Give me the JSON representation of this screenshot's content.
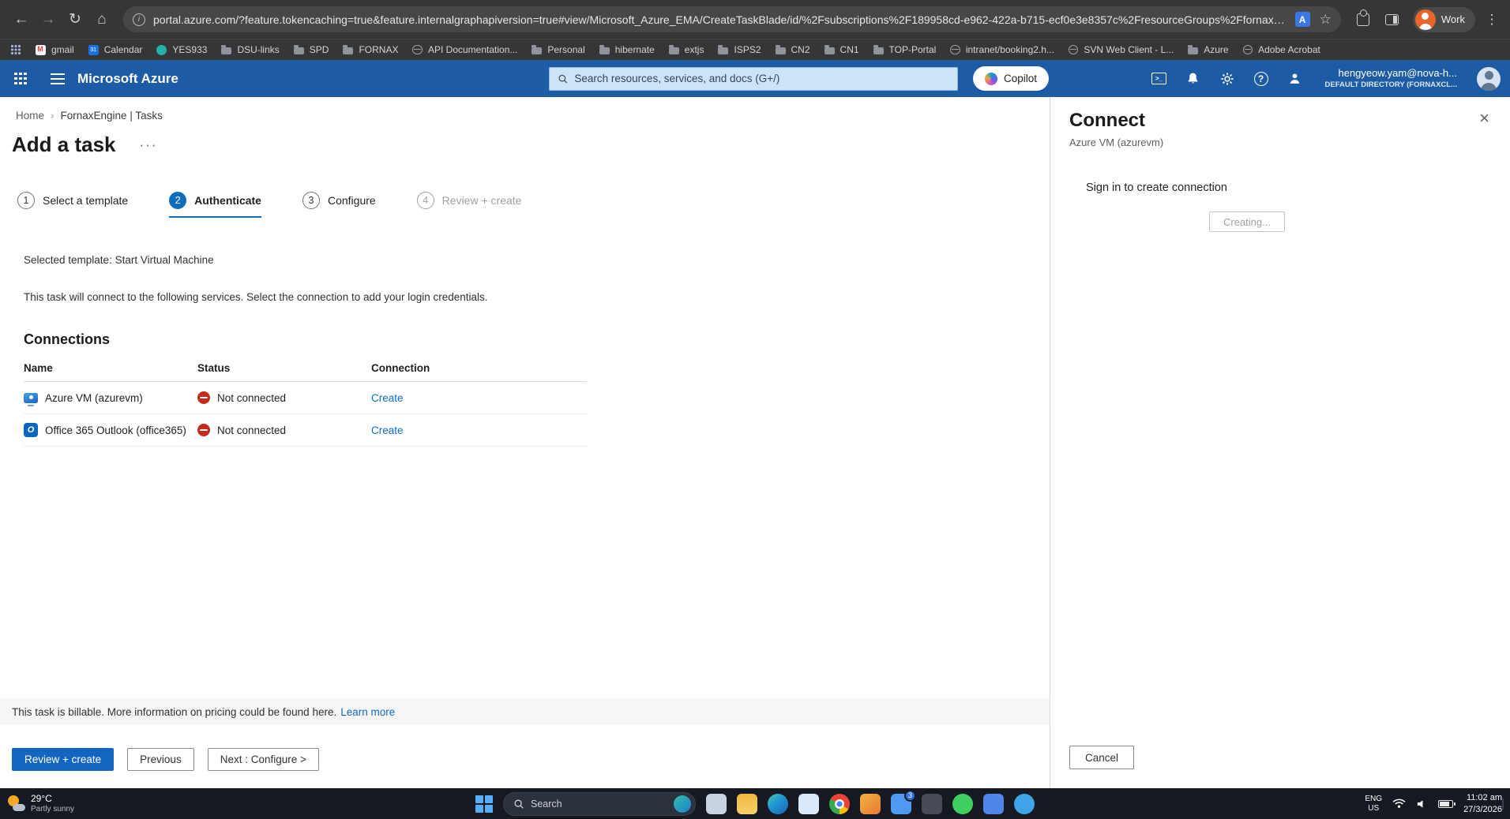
{
  "browser": {
    "url": "portal.azure.com/?feature.tokencaching=true&feature.internalgraphapiversion=true#view/Microsoft_Azure_EMA/CreateTaskBlade/id/%2Fsubscriptions%2F189958cd-e962-422a-b715-ecf0e3e8357c%2FresourceGroups%2Ffornaxtes...",
    "profile_label": "Work",
    "bookmarks": [
      {
        "label": "gmail",
        "icon": "gmail"
      },
      {
        "label": "Calendar",
        "icon": "calendar"
      },
      {
        "label": "YES933",
        "icon": "site"
      },
      {
        "label": "DSU-links",
        "icon": "folder"
      },
      {
        "label": "SPD",
        "icon": "folder"
      },
      {
        "label": "FORNAX",
        "icon": "folder"
      },
      {
        "label": "API Documentation...",
        "icon": "globe"
      },
      {
        "label": "Personal",
        "icon": "folder"
      },
      {
        "label": "hibernate",
        "icon": "folder"
      },
      {
        "label": "extjs",
        "icon": "folder"
      },
      {
        "label": "ISPS2",
        "icon": "folder"
      },
      {
        "label": "CN2",
        "icon": "folder"
      },
      {
        "label": "CN1",
        "icon": "folder"
      },
      {
        "label": "TOP-Portal",
        "icon": "folder"
      },
      {
        "label": "intranet/booking2.h...",
        "icon": "globe"
      },
      {
        "label": "SVN Web Client - L...",
        "icon": "globe"
      },
      {
        "label": "Azure",
        "icon": "folder"
      },
      {
        "label": "Adobe Acrobat",
        "icon": "globe"
      }
    ]
  },
  "azure": {
    "brand": "Microsoft Azure",
    "search_placeholder": "Search resources, services, and docs (G+/)",
    "copilot_label": "Copilot",
    "user_email": "hengyeow.yam@nova-h...",
    "user_directory": "DEFAULT DIRECTORY (FORNAXCL..."
  },
  "breadcrumb": {
    "home": "Home",
    "current": "FornaxEngine | Tasks"
  },
  "page": {
    "title": "Add a task",
    "steps": [
      {
        "num": "1",
        "label": "Select a template",
        "state": "done"
      },
      {
        "num": "2",
        "label": "Authenticate",
        "state": "active"
      },
      {
        "num": "3",
        "label": "Configure",
        "state": "upcoming"
      },
      {
        "num": "4",
        "label": "Review + create",
        "state": "disabled"
      }
    ],
    "selected_template": "Selected template: Start Virtual Machine",
    "intro": "This task will connect to the following services. Select the connection to add your login credentials.",
    "connections_heading": "Connections",
    "columns": [
      "Name",
      "Status",
      "Connection"
    ],
    "rows": [
      {
        "name": "Azure VM (azurevm)",
        "status": "Not connected",
        "action": "Create",
        "icon": "azure-vm"
      },
      {
        "name": "Office 365 Outlook (office365)",
        "status": "Not connected",
        "action": "Create",
        "icon": "outlook"
      }
    ],
    "billable_text": "This task is billable. More information on pricing could be found here.",
    "billable_link": "Learn more",
    "buttons": {
      "review": "Review + create",
      "previous": "Previous",
      "next": "Next : Configure >"
    }
  },
  "panel": {
    "title": "Connect",
    "subtitle": "Azure VM (azurevm)",
    "message": "Sign in to create connection",
    "creating": "Creating...",
    "cancel": "Cancel"
  },
  "taskbar": {
    "weather_temp": "29°C",
    "weather_desc": "Partly sunny",
    "search_label": "Search",
    "apps": [
      {
        "name": "task-view-icon",
        "cls": "app-gray",
        "shape": "sq"
      },
      {
        "name": "file-explorer-icon",
        "cls": "app-folder",
        "shape": "sq"
      },
      {
        "name": "edge-icon",
        "cls": "app-edge",
        "shape": "circle"
      },
      {
        "name": "mail-icon",
        "cls": "app-mail",
        "shape": "sq"
      },
      {
        "name": "chrome-icon",
        "cls": "app-chrome",
        "shape": "circle"
      },
      {
        "name": "photos-icon",
        "cls": "app-photos",
        "shape": "sq"
      },
      {
        "name": "teams-chat-icon",
        "cls": "app-teams",
        "shape": "sq",
        "badge": "3"
      },
      {
        "name": "onenote-icon",
        "cls": "app-dark",
        "shape": "sq"
      },
      {
        "name": "whatsapp-icon",
        "cls": "app-whatsapp",
        "shape": "circle"
      },
      {
        "name": "notepad-icon",
        "cls": "app-notepad",
        "shape": "sq"
      },
      {
        "name": "people-icon",
        "cls": "app-people",
        "shape": "circle"
      }
    ],
    "tray": [
      {
        "name": "tray-onedrive-icon",
        "cls": "t-blue"
      },
      {
        "name": "tray-whatsapp-icon",
        "cls": "t-green"
      },
      {
        "name": "tray-app-icon-3",
        "cls": "t-purple"
      },
      {
        "name": "tray-app-icon-4",
        "cls": "t-orange"
      },
      {
        "name": "tray-app-icon-5",
        "cls": "t-dark"
      }
    ],
    "lang1": "ENG",
    "lang2": "US",
    "time": "11:02 am",
    "date": "27/3/2026"
  }
}
